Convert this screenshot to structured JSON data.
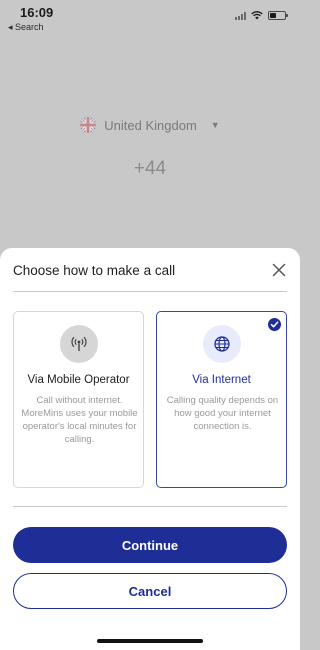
{
  "status_bar": {
    "time": "16:09",
    "back_app": "◂ Search"
  },
  "background": {
    "country": "United Kingdom",
    "dial_code": "+44",
    "flag_icon": "uk-flag-icon",
    "caret_icon": "chevron-down-icon"
  },
  "sheet": {
    "title": "Choose how to make a call",
    "close_icon": "close-icon",
    "options": [
      {
        "title": "Via Mobile Operator",
        "description": "Call without internet. MoreMins uses your mobile operator's local minutes for calling.",
        "icon": "antenna-icon",
        "selected": false
      },
      {
        "title": "Via Internet",
        "description": "Calling quality depends on how good your internet connection is.",
        "icon": "globe-icon",
        "selected": true
      }
    ],
    "continue_label": "Continue",
    "cancel_label": "Cancel"
  },
  "colors": {
    "accent": "#1f2e96",
    "overlay": "#c8c8c8"
  }
}
